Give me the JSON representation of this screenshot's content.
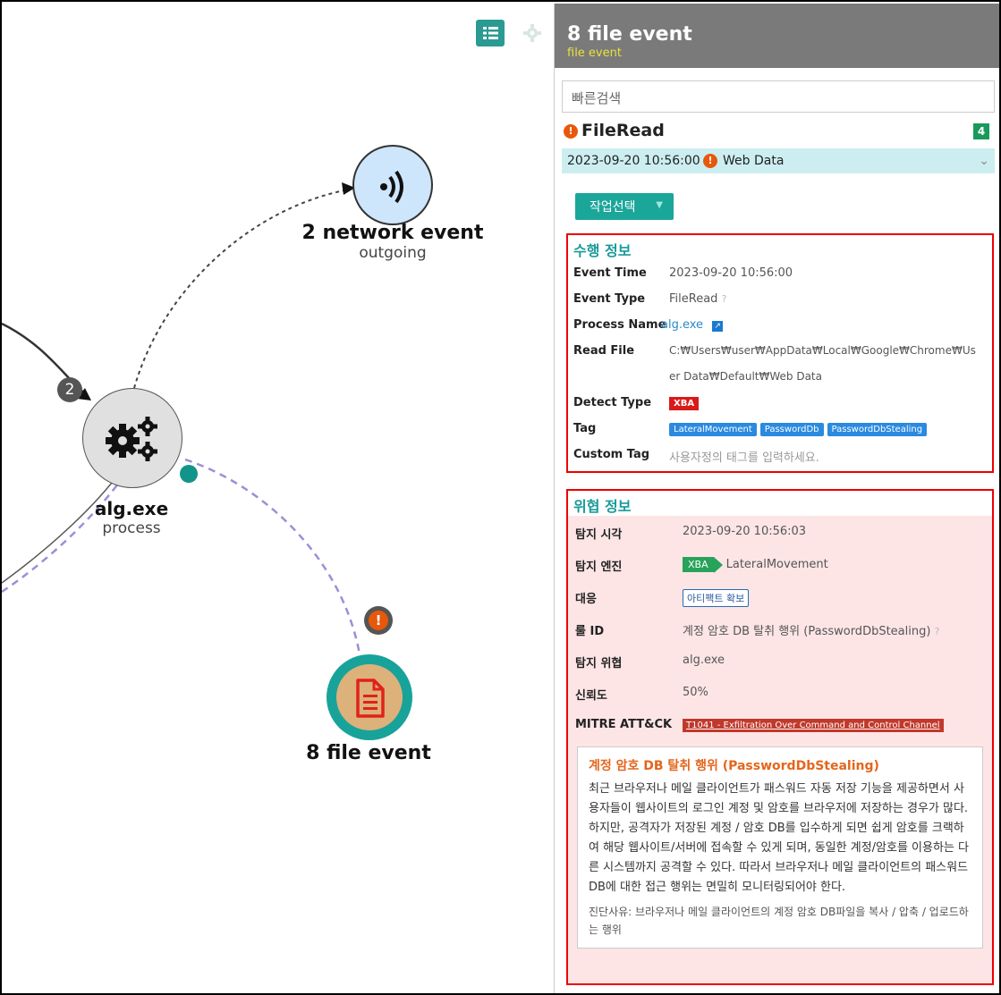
{
  "graph": {
    "network_node": {
      "title": "2 network event",
      "subtitle": "outgoing"
    },
    "process_node": {
      "title": "alg.exe",
      "subtitle": "process",
      "edge_count": "2"
    },
    "file_node": {
      "title": "8 file event",
      "alert": "!"
    }
  },
  "toolbar": {
    "list_icon": "list-icon",
    "settings_icon": "gear-icon"
  },
  "panel": {
    "title": "8 file event",
    "subtitle": "file event",
    "search_placeholder": "빠른검색",
    "event": {
      "name": "FileRead",
      "count": "4"
    },
    "time_row": {
      "time": "2023-09-20 10:56:00",
      "label": "Web Data"
    },
    "action_button": "작업선택",
    "exec_info": {
      "title": "수행 정보",
      "rows": [
        {
          "key": "Event Time",
          "value": "2023-09-20 10:56:00"
        },
        {
          "key": "Event Type",
          "value": "FileRead"
        },
        {
          "key": "Process Name",
          "value": "alg.exe"
        },
        {
          "key": "Read File",
          "value": "C:₩Users₩user₩AppData₩Local₩Google₩Chrome₩Us",
          "value2": "er Data₩Default₩Web Data"
        },
        {
          "key": "Detect Type",
          "value": "XBA"
        },
        {
          "key": "Tag",
          "tags": [
            "LateralMovement",
            "PasswordDb",
            "PasswordDbStealing"
          ]
        },
        {
          "key": "Custom Tag",
          "value": "사용자정의 태그를 입력하세요."
        }
      ]
    },
    "threat_info": {
      "title": "위협 정보",
      "rows": [
        {
          "key": "탐지 시각",
          "value": "2023-09-20 10:56:03"
        },
        {
          "key": "탐지 엔진",
          "engine": "XBA",
          "value": "LateralMovement"
        },
        {
          "key": "대응",
          "value": "아티팩트 확보"
        },
        {
          "key": "룰 ID",
          "value": "계정 암호 DB 탈취 행위 (PasswordDbStealing)"
        },
        {
          "key": "탐지 위협",
          "value": "alg.exe"
        },
        {
          "key": "신뢰도",
          "value": "50%"
        },
        {
          "key": "MITRE ATT&CK",
          "value": "T1041 - Exfiltration Over Command and Control Channel"
        }
      ],
      "description": {
        "title": "계정 암호 DB 탈취 행위 (PasswordDbStealing)",
        "body": "최근 브라우저나 메일 클라이언트가 패스워드 자동 저장 기능을 제공하면서 사용자들이 웹사이트의 로그인 계정 및 암호를 브라우저에 저장하는 경우가 많다. 하지만, 공격자가 저장된 계정 / 암호 DB를 입수하게 되면 쉽게 암호를 크랙하여 해당 웹사이트/서버에 접속할 수 있게 되며, 동일한 계정/암호를 이용하는 다른 시스템까지 공격할 수 있다. 따라서 브라우저나 메일 클라이언트의 패스워드 DB에 대한 접근 행위는 면밀히 모니터링되어야 한다.",
        "footer": "진단사유: 브라우저나 메일 클라이언트의 계정 암호 DB파일을 복사 / 압축 / 업로드하는 행위"
      }
    }
  },
  "colors": {
    "accent": "#1ba69a",
    "alert": "#e8580c",
    "highlight_box": "#ee0000",
    "threat_bg": "#fde5e6"
  }
}
